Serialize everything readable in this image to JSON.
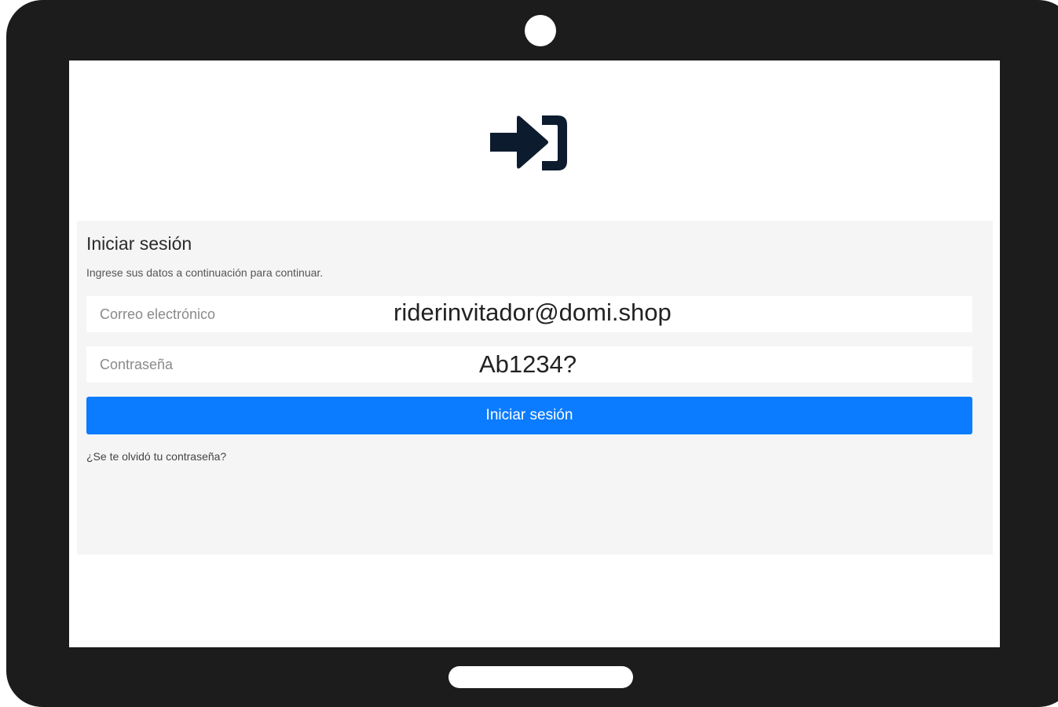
{
  "logo": {
    "icon": "sign-in-icon"
  },
  "login": {
    "title": "Iniciar sesión",
    "subtitle": "Ingrese sus datos a continuación para continuar.",
    "email": {
      "label": "Correo electrónico",
      "value": "riderinvitador@domi.shop"
    },
    "password": {
      "label": "Contraseña",
      "value": "Ab1234?"
    },
    "submit_label": "Iniciar sesión",
    "forgot_link": "¿Se te olvidó tu contraseña?"
  },
  "colors": {
    "frame": "#1c1c1c",
    "panel": "#f5f5f5",
    "button": "#0b7cff",
    "icon": "#0d1b2e"
  }
}
